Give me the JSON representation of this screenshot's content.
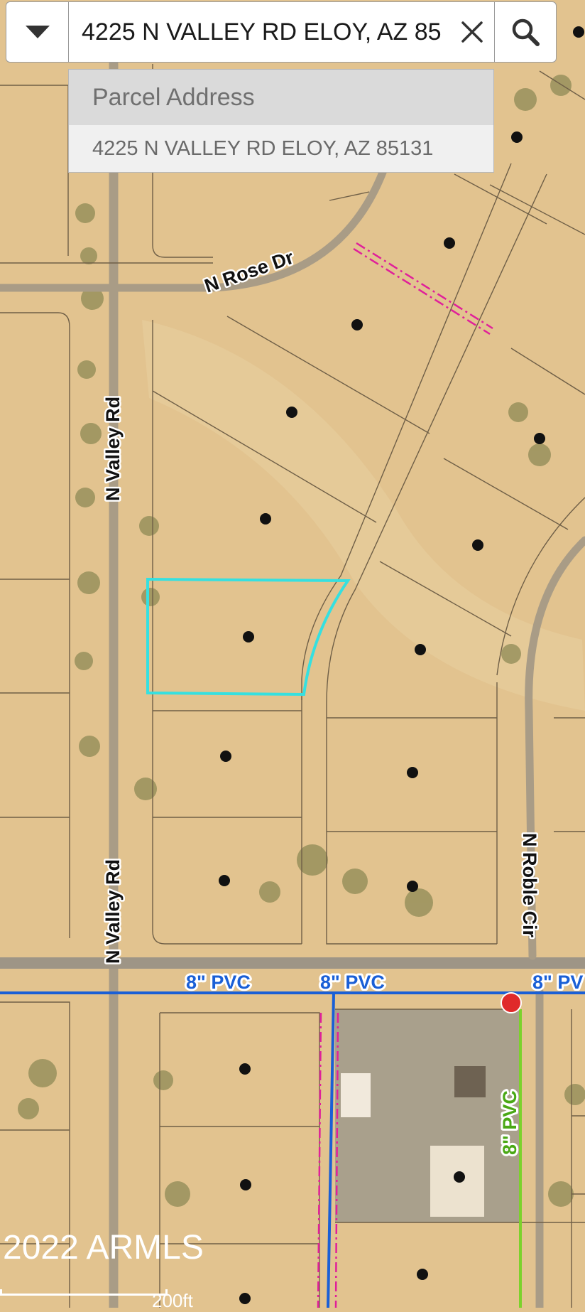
{
  "search": {
    "value": "4225 N VALLEY RD ELOY, AZ 85131",
    "visible_text": "4225 N VALLEY RD ELOY, AZ 85"
  },
  "suggestions": {
    "header": "Parcel Address",
    "items": [
      "4225 N VALLEY RD ELOY, AZ 85131"
    ]
  },
  "map": {
    "labels": {
      "rose": "N Rose Dr",
      "valley": "N Valley Rd",
      "roble": "N Roble Cir",
      "pipe": "8\" PVC",
      "pipe_partial": "8\" PV"
    },
    "copyright": "2022 ARMLS",
    "scale": "200ft",
    "colors": {
      "terrain": "#e2c38f",
      "parcel_highlight": "#35e0e0",
      "water_main": "#1a5fd6",
      "sewer_line": "#7cd22b",
      "easement": "#e0209a",
      "hydrant": "#e02a2a"
    }
  },
  "icons": {
    "dropdown": "caret-down-icon",
    "clear": "close-icon",
    "search": "search-icon",
    "hydrant": "hydrant-icon"
  }
}
